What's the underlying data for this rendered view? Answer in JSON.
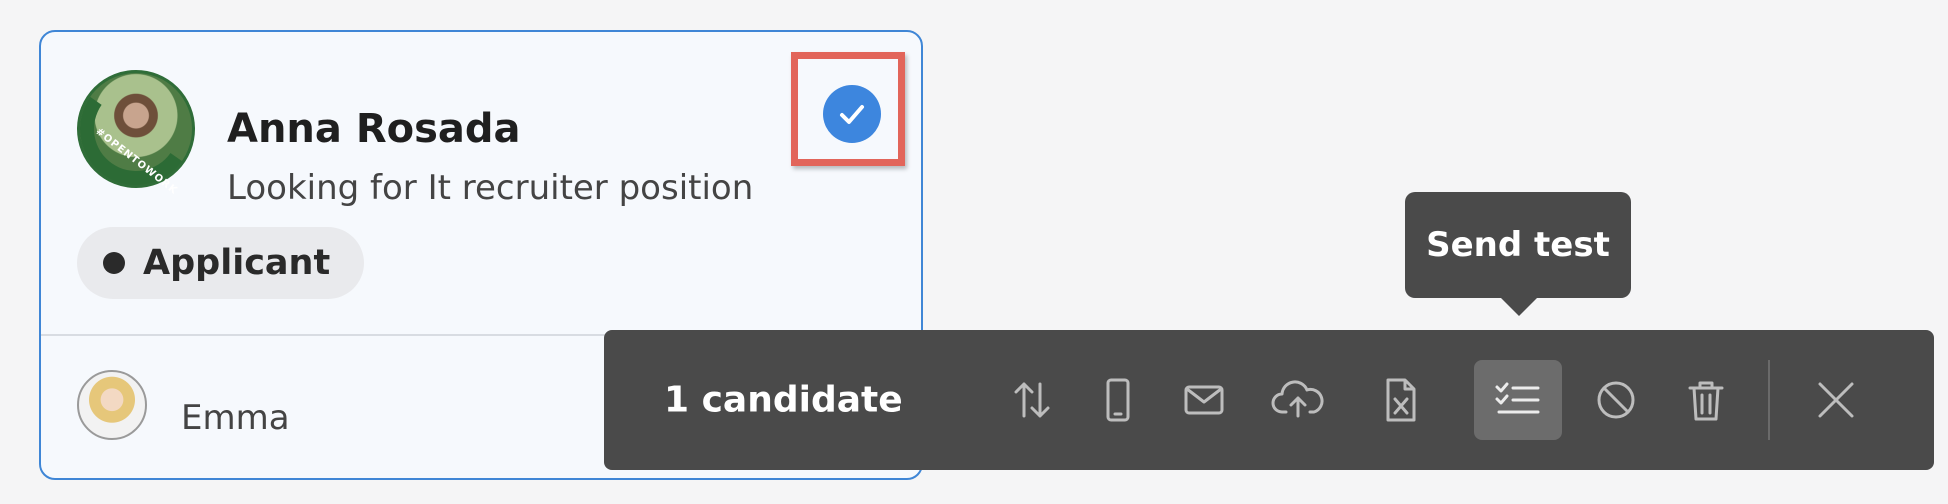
{
  "candidate": {
    "name": "Anna Rosada",
    "headline": "Looking for It recruiter position",
    "avatar_badge": "#OPENTOWORK",
    "stage": "Applicant",
    "selected": true,
    "recruiter_name": "Emma"
  },
  "toolbar": {
    "selection_count": "1 candidate",
    "buttons": [
      {
        "icon": "sort-arrows-icon",
        "label": "Move"
      },
      {
        "icon": "mobile-icon",
        "label": "SMS"
      },
      {
        "icon": "envelope-icon",
        "label": "Email"
      },
      {
        "icon": "cloud-upload-icon",
        "label": "Upload"
      },
      {
        "icon": "excel-file-icon",
        "label": "Export"
      },
      {
        "icon": "checklist-icon",
        "label": "Send test",
        "active": true
      },
      {
        "icon": "block-icon",
        "label": "Disqualify"
      },
      {
        "icon": "trash-icon",
        "label": "Delete"
      }
    ],
    "close_icon": "close-icon"
  },
  "tooltip": {
    "text": "Send test"
  },
  "colors": {
    "card_border": "#3f86d6",
    "check_blue": "#3d86de",
    "highlight_red": "#e2655a",
    "toolbar_bg": "#4a4a4a"
  }
}
